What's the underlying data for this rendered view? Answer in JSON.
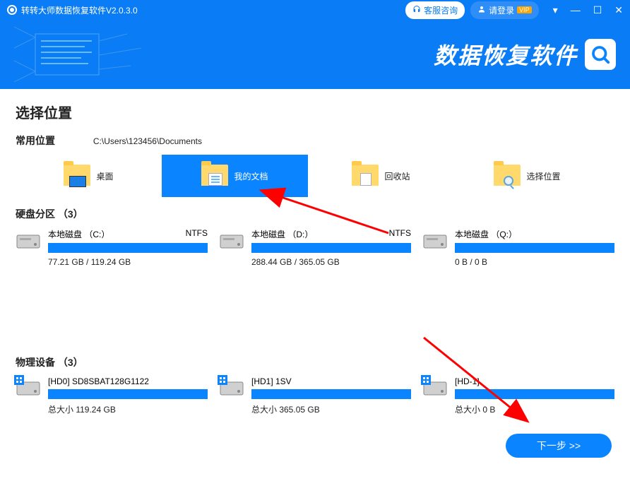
{
  "titlebar": {
    "appTitle": "转转大师数据恢复软件V2.0.3.0",
    "supportLabel": "客服咨询",
    "loginLabel": "请登录",
    "vipLabel": "VIP"
  },
  "banner": {
    "title": "数据恢复软件"
  },
  "sections": {
    "selectLocation": "选择位置",
    "commonLocations": "常用位置",
    "commonPath": "C:\\Users\\123456\\Documents",
    "diskPartitions": "硬盘分区 （3）",
    "physicalDevices": "物理设备 （3）"
  },
  "locations": [
    {
      "label": "桌面",
      "icon": "desktop"
    },
    {
      "label": "我的文档",
      "icon": "documents",
      "selected": true
    },
    {
      "label": "回收站",
      "icon": "recycle"
    },
    {
      "label": "选择位置",
      "icon": "search"
    }
  ],
  "partitions": [
    {
      "name": "本地磁盘 （C:）",
      "fs": "NTFS",
      "usage": "77.21 GB / 119.24 GB"
    },
    {
      "name": "本地磁盘 （D:）",
      "fs": "NTFS",
      "usage": "288.44 GB / 365.05 GB"
    },
    {
      "name": "本地磁盘 （Q:）",
      "fs": "",
      "usage": "0 B / 0 B"
    }
  ],
  "devices": [
    {
      "name": "[HD0] SD8SBAT128G1122",
      "size": "总大小 119.24 GB"
    },
    {
      "name": "[HD1] 1SV",
      "size": "总大小 365.05 GB"
    },
    {
      "name": "[HD-1]",
      "size": "总大小 0 B"
    }
  ],
  "nextButton": "下一步 >>"
}
